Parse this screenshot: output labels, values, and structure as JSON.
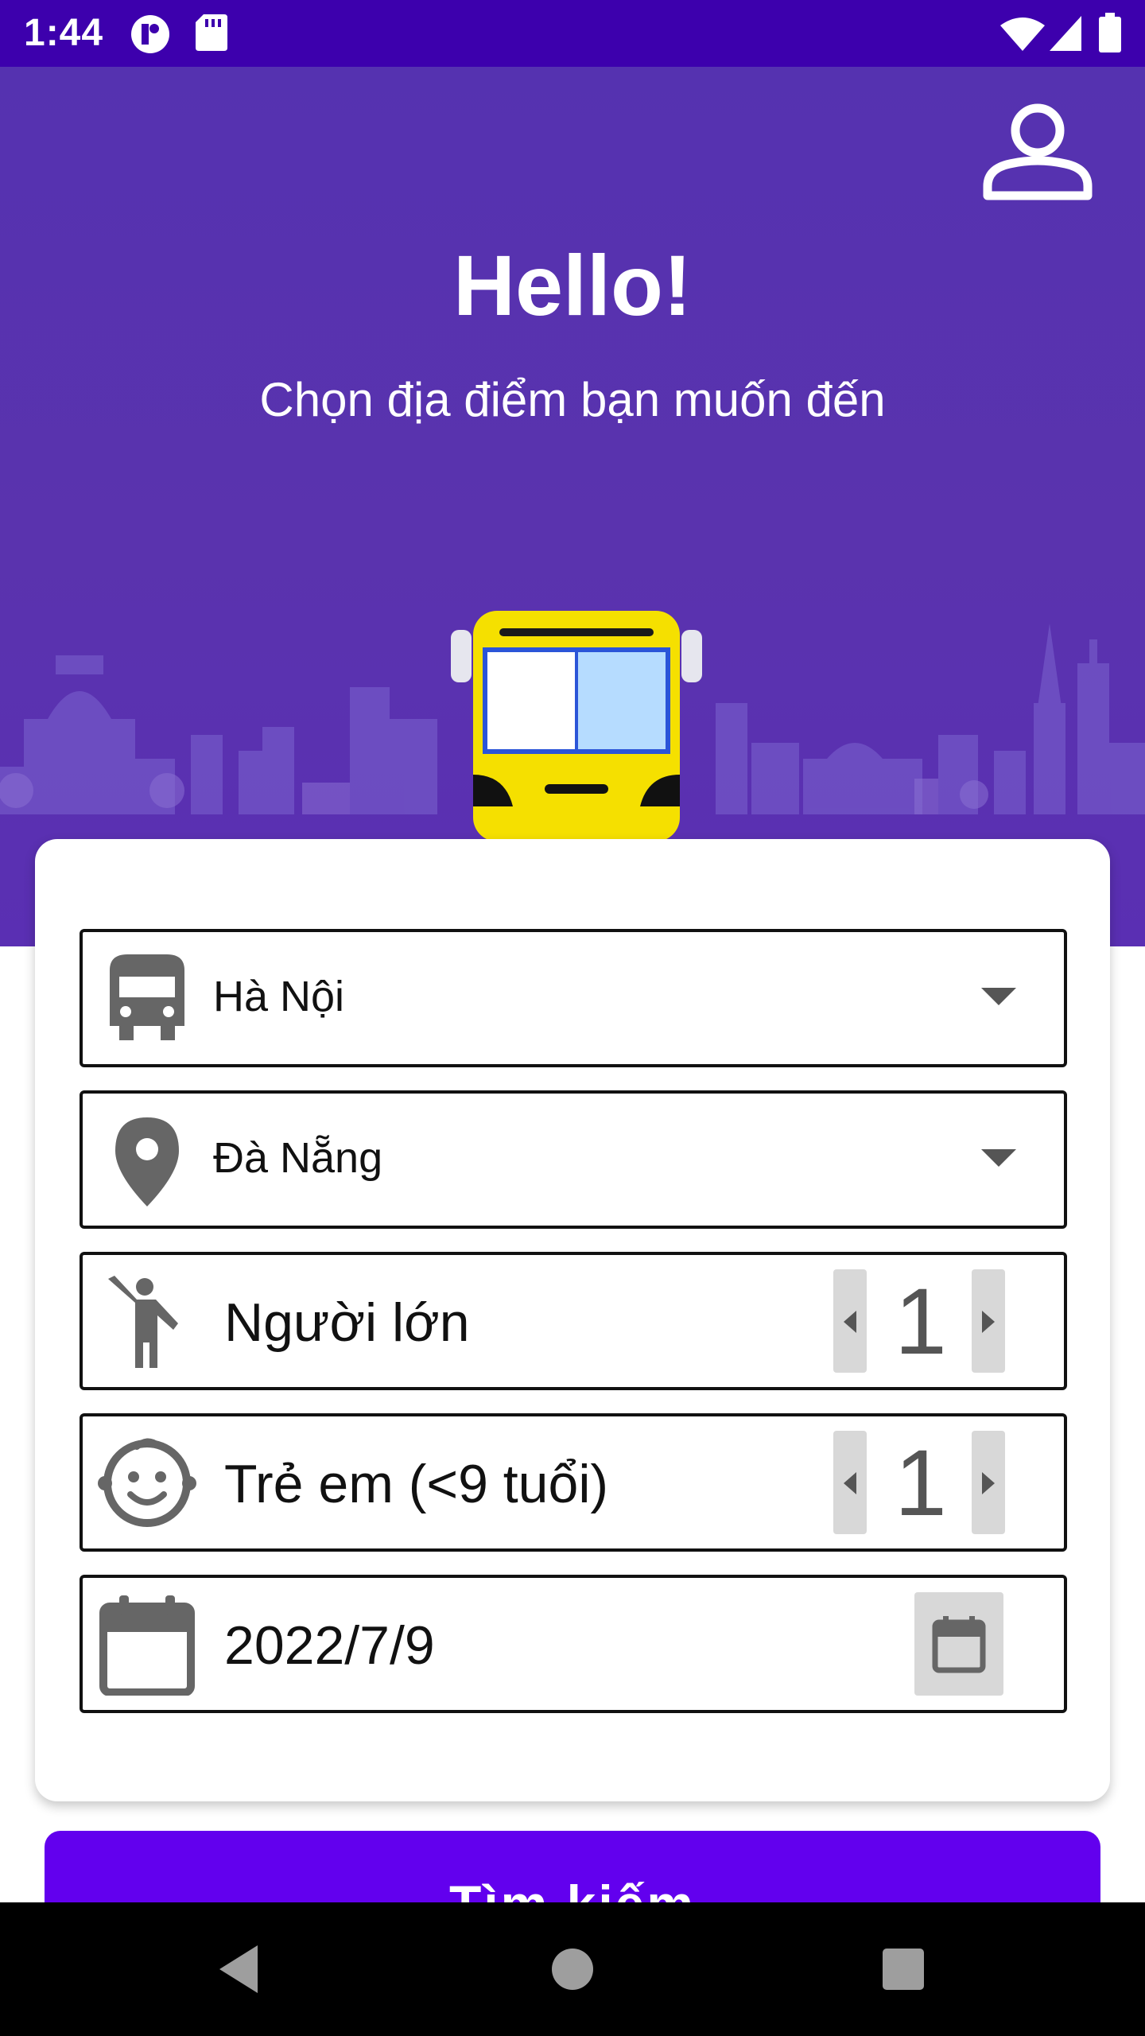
{
  "status_bar": {
    "time": "1:44",
    "icons": [
      "app-notification-icon",
      "sd-card-icon",
      "wifi-icon",
      "signal-icon",
      "battery-icon"
    ]
  },
  "header": {
    "title": "Hello!",
    "subtitle": "Chọn địa điểm bạn muốn đến",
    "profile_icon": "person-icon"
  },
  "colors": {
    "status_bar": "#3d00ad",
    "hero_bg": "#5532b0",
    "primary": "#6200ee",
    "bus_yellow": "#f5e000",
    "bus_window": "#b6dcff"
  },
  "form": {
    "from": {
      "icon": "bus-icon",
      "value": "Hà Nội"
    },
    "to": {
      "icon": "location-pin-icon",
      "value": "Đà Nẵng"
    },
    "adults": {
      "icon": "person-waving-icon",
      "label": "Người lớn",
      "count": "1"
    },
    "children": {
      "icon": "baby-face-icon",
      "label": "Trẻ em (<9 tuổi)",
      "count": "1"
    },
    "date": {
      "icon": "calendar-icon",
      "value": "2022/7/9"
    }
  },
  "search_button": {
    "label": "Tìm kiếm"
  },
  "nav_bar": {
    "buttons": [
      "back-icon",
      "home-icon",
      "recents-icon"
    ]
  }
}
